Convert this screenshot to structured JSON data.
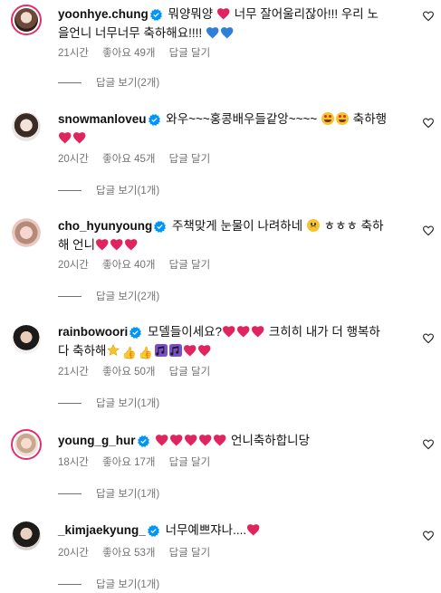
{
  "comments": [
    {
      "username": "yoonhye.chung",
      "parts": [
        "뭐양뭐양",
        "너무 잘어울리잖아!!! 우리 노",
        "을언니 너무너무 축하해요!!!!"
      ],
      "time": "21시간",
      "likes": "좋아요 49개",
      "reply": "답글 달기",
      "view_replies": "답글 보기(2개)"
    },
    {
      "username": "snowmanloveu",
      "parts": [
        "와우~~~홍콩배우들같앙~~~~",
        "축하행"
      ],
      "time": "20시간",
      "likes": "좋아요 45개",
      "reply": "답글 달기",
      "view_replies": "답글 보기(1개)"
    },
    {
      "username": "cho_hyunyoung",
      "parts": [
        "주책맞게 눈물이 나려하네",
        "ㅎㅎㅎ 축하",
        "해 언니"
      ],
      "time": "20시간",
      "likes": "좋아요 40개",
      "reply": "답글 달기",
      "view_replies": "답글 보기(2개)"
    },
    {
      "username": "rainbowoori",
      "parts": [
        "모델들이세요?",
        "크히히 내가 더 행복하",
        "다 축하해"
      ],
      "time": "21시간",
      "likes": "좋아요 50개",
      "reply": "답글 달기",
      "view_replies": "답글 보기(1개)"
    },
    {
      "username": "young_g_hur",
      "parts": [
        "언니축하합니당"
      ],
      "time": "18시간",
      "likes": "좋아요 17개",
      "reply": "답글 달기",
      "view_replies": "답글 보기(1개)"
    },
    {
      "username": "_kimjaekyung_",
      "parts": [
        "너무예쁘쟈나...."
      ],
      "time": "20시간",
      "likes": "좋아요 53개",
      "reply": "답글 달기",
      "view_replies": "답글 보기(1개)"
    }
  ],
  "colors": {
    "verified": "#0095f6",
    "heart_red": "#e0245e",
    "heart_blue": "#2f7fd6",
    "muted_text": "#737373",
    "story_ring": "#e1306c"
  },
  "icons": [
    "verified-badge-icon",
    "heart-outline-icon",
    "red-heart-emoji",
    "blue-heart-emoji",
    "star-struck-emoji",
    "sad-face-emoji",
    "thumbs-up-emoji",
    "music-notes-emoji",
    "sparkle-star-emoji"
  ]
}
